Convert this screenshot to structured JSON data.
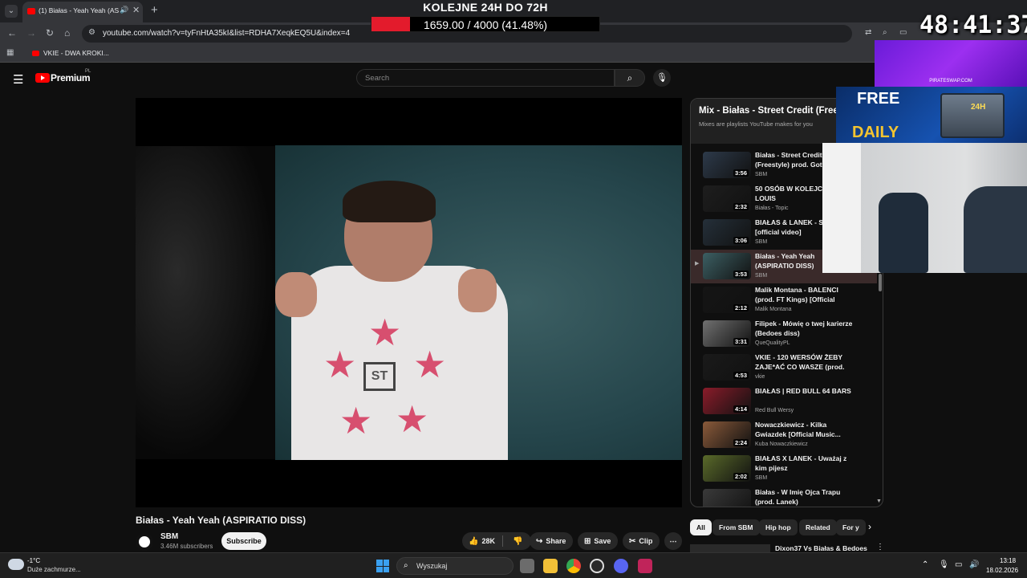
{
  "browser": {
    "tab_title": "(1) Białas - Yeah Yeah (ASPI",
    "url": "youtube.com/watch?v=tyFnHtA35kI&list=RDHA7XeqkEQ5U&index=4",
    "bookmark": "VKIE - DWA KROKI..."
  },
  "overlay": {
    "title": "KOLEJNE 24H DO 72H",
    "progress_text_value": "1659.00",
    "progress_text_rest": "/ 4000 (41.48%)",
    "progress_fraction": 0.4148,
    "timer": "48:41:37",
    "promo_small": "PIRATESWAP.COM",
    "promo_free": "FREE",
    "promo_daily": "DAILY",
    "promo_24h": "24H"
  },
  "youtube": {
    "brand": "Premium",
    "country": "PL",
    "search_placeholder": "Search"
  },
  "video": {
    "title": "Białas - Yeah Yeah (ASPIRATIO DISS)",
    "channel": "SBM",
    "subscribers": "3.46M subscribers",
    "subscribe_label": "Subscribe",
    "likes": "28K",
    "share_label": "Share",
    "save_label": "Save",
    "clip_label": "Clip",
    "shirt_logo": "ST"
  },
  "playlist": {
    "title": "Mix - Białas - Street Credit (Freestyle)",
    "subtitle": "Mixes are playlists YouTube makes for you",
    "items": [
      {
        "title": "Białas - Street Credit (Freestyle) prod. Got Beatz",
        "channel": "SBM",
        "duration": "3:56",
        "color": "#2d3a4a"
      },
      {
        "title": "50 OSÓB W KOLEJCE DO LOUIS",
        "channel": "Białas - Topic",
        "duration": "2:32",
        "color": "#1e1e1e"
      },
      {
        "title": "BIAŁAS & LANEK - SIMBA [official video]",
        "channel": "SBM",
        "duration": "3:06",
        "color": "#25303a"
      },
      {
        "title": "Białas - Yeah Yeah (ASPIRATIO DISS)",
        "channel": "SBM",
        "duration": "3:53",
        "color": "#3c5f63"
      },
      {
        "title": "Malik Montana - BALENCI (prod. FT Kings) [Official Music Video]",
        "channel": "Malik Montana",
        "duration": "2:12",
        "color": "#151515"
      },
      {
        "title": "Filipek - Mówię o twej karierze (Bedoes diss)",
        "channel": "QueQualityPL",
        "duration": "3:31",
        "color": "#707070"
      },
      {
        "title": "VKIE - 120 WERSÓW ŻEBY ZAJE*AĆ CO WASZE (prod. L...",
        "channel": "vkie",
        "duration": "4:53",
        "color": "#1a1a1a"
      },
      {
        "title": "BIAŁAS | RED BULL 64 BARS",
        "channel": "Red Bull Wersy",
        "duration": "4:14",
        "color": "#8a1c2a"
      },
      {
        "title": "Nowaczkiewicz - Kilka Gwiazdek [Official Music...",
        "channel": "Kuba Nowaczkiewicz",
        "duration": "2:24",
        "color": "#8a5a3a"
      },
      {
        "title": "BIAŁAS X LANEK - Uważaj z kim pijesz",
        "channel": "SBM",
        "duration": "2:02",
        "color": "#5a6a2a"
      },
      {
        "title": "Białas - W Imię Ojca Trapu (prod. Lanek)",
        "channel": "SBM",
        "duration": "2:43",
        "color": "#3a3a3a"
      }
    ]
  },
  "chips": [
    "All",
    "From SBM",
    "Hip hop",
    "Related",
    "For y"
  ],
  "next_video": "Dixon37 Vs Białas & Bedoes",
  "taskbar": {
    "temp": "-1°C",
    "weather": "Duże zachmurze...",
    "search": "Wyszukaj",
    "time": "13:18",
    "date": "18.02.2026"
  }
}
